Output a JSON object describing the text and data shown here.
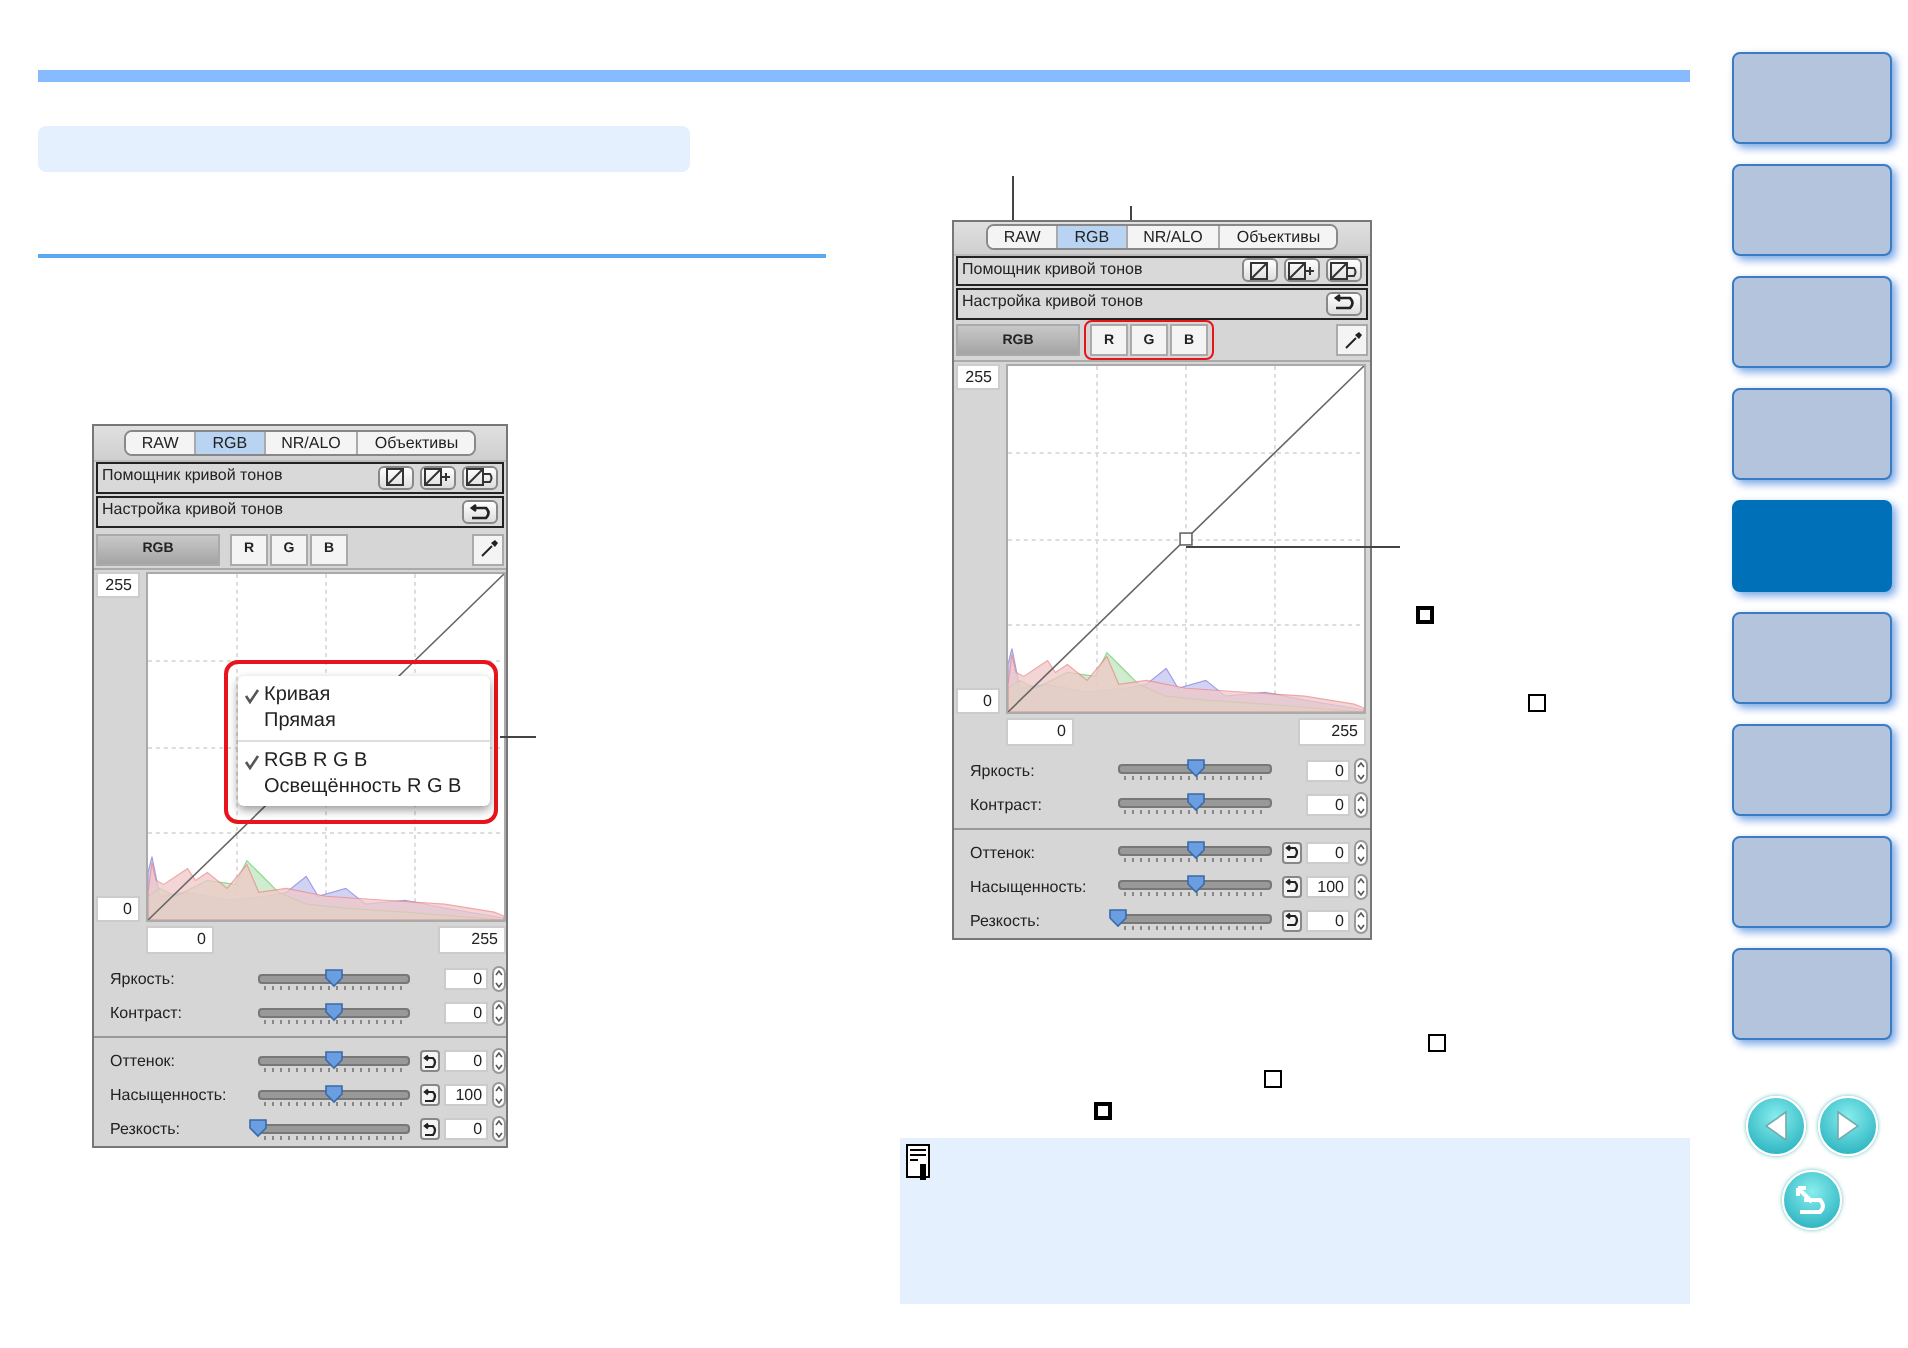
{
  "panels": [
    {
      "tabs": [
        {
          "label": "RAW",
          "selected": false
        },
        {
          "label": "RGB",
          "selected": true
        },
        {
          "label": "NR/ALO",
          "selected": false
        },
        {
          "label": "Объективы",
          "selected": false
        }
      ],
      "helper": "Помощник кривой тонов",
      "settings": "Настройка кривой тонов",
      "channels": [
        {
          "label": "RGB",
          "selected": true
        },
        {
          "label": "R",
          "selected": false
        },
        {
          "label": "G",
          "selected": false
        },
        {
          "label": "B",
          "selected": false
        }
      ],
      "channels_highlighted": false,
      "input_high": "255",
      "input_low": "0",
      "output_low": "0",
      "output_high": "255",
      "curve_point": false,
      "menu": {
        "highlighted": true,
        "groups": [
          [
            {
              "label": "Кривая",
              "checked": true
            },
            {
              "label": "Прямая",
              "checked": false
            }
          ],
          [
            {
              "label": "RGB R G B",
              "checked": true
            },
            {
              "label": "Освещённость R G B",
              "checked": false
            }
          ]
        ]
      },
      "adjust_groups": [
        [
          {
            "label": "Яркость:",
            "value": "0",
            "level": 0.5,
            "reset": false
          },
          {
            "label": "Контраст:",
            "value": "0",
            "level": 0.5,
            "reset": false
          }
        ],
        [
          {
            "label": "Оттенок:",
            "value": "0",
            "level": 0.5,
            "reset": true
          },
          {
            "label": "Насыщенность:",
            "value": "100",
            "level": 0.5,
            "reset": true
          },
          {
            "label": "Резкость:",
            "value": "0",
            "level": 0,
            "reset": true
          }
        ]
      ]
    },
    {
      "tabs": [
        {
          "label": "RAW",
          "selected": false
        },
        {
          "label": "RGB",
          "selected": true
        },
        {
          "label": "NR/ALO",
          "selected": false
        },
        {
          "label": "Объективы",
          "selected": false
        }
      ],
      "helper": "Помощник кривой тонов",
      "settings": "Настройка кривой тонов",
      "channels": [
        {
          "label": "RGB",
          "selected": true
        },
        {
          "label": "R",
          "selected": false
        },
        {
          "label": "G",
          "selected": false
        },
        {
          "label": "B",
          "selected": false
        }
      ],
      "channels_highlighted": true,
      "input_high": "255",
      "input_low": "0",
      "output_low": "0",
      "output_high": "255",
      "curve_point": true,
      "adjust_groups": [
        [
          {
            "label": "Яркость:",
            "value": "0",
            "level": 0.5,
            "reset": false
          },
          {
            "label": "Контраст:",
            "value": "0",
            "level": 0.5,
            "reset": false
          }
        ],
        [
          {
            "label": "Оттенок:",
            "value": "0",
            "level": 0.5,
            "reset": true
          },
          {
            "label": "Насыщенность:",
            "value": "100",
            "level": 0.5,
            "reset": true
          },
          {
            "label": "Резкость:",
            "value": "0",
            "level": 0,
            "reset": true
          }
        ]
      ]
    }
  ],
  "nav_tabs": [
    {
      "selected": false
    },
    {
      "selected": false
    },
    {
      "selected": false
    },
    {
      "selected": false
    },
    {
      "selected": true
    },
    {
      "selected": false
    },
    {
      "selected": false
    },
    {
      "selected": false
    },
    {
      "selected": false
    }
  ]
}
